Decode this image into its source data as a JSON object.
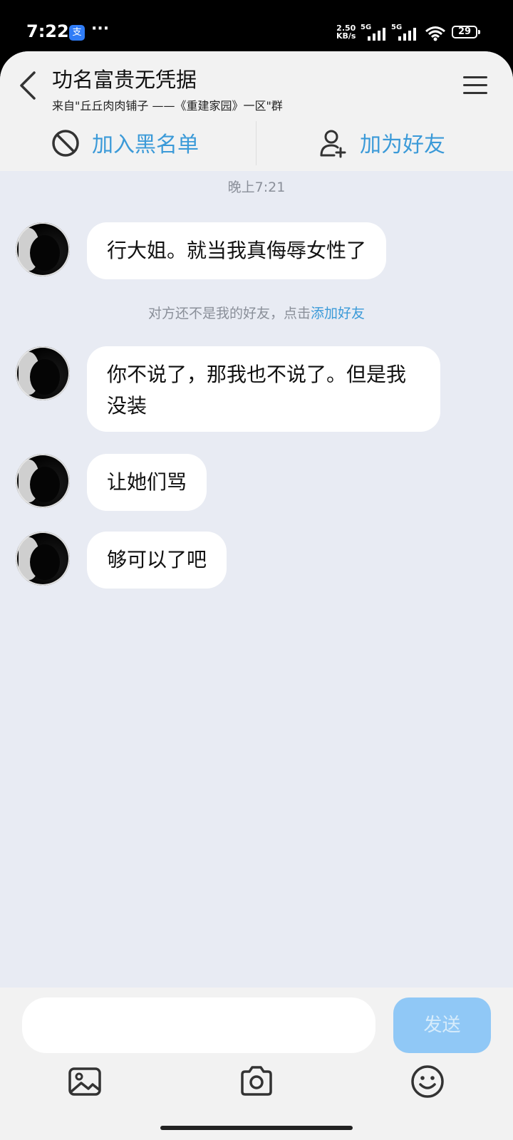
{
  "status_bar": {
    "time": "7:22",
    "app_icon": "支",
    "dots": "···",
    "net_speed_value": "2.50",
    "net_speed_unit": "KB/s",
    "signal1_label": "5G",
    "signal2_label": "5G",
    "battery": "29"
  },
  "header": {
    "title": "功名富贵无凭据",
    "subtitle": "来自\"丘丘肉肉铺子 ——《重建家园》一区\"群"
  },
  "actions": {
    "block_label": "加入黑名单",
    "add_friend_label": "加为好友"
  },
  "chat": {
    "timestamp": "晚上7:21",
    "notice_text": "对方还不是我的好友，点击",
    "notice_link": "添加好友",
    "messages": [
      {
        "text": "行大姐。就当我真侮辱女性了"
      },
      {
        "text": "你不说了，那我也不说了。但是我没装"
      },
      {
        "text": "让她们骂"
      },
      {
        "text": "够可以了吧"
      }
    ]
  },
  "input": {
    "placeholder": "",
    "send_label": "发送"
  },
  "icons": {
    "back": "back-arrow-icon",
    "menu": "menu-icon",
    "block": "block-icon",
    "add_friend": "add-friend-icon",
    "image": "image-icon",
    "camera": "camera-icon",
    "emoji": "emoji-icon"
  },
  "colors": {
    "accent": "#3b9ad8",
    "chat_background": "#e8ebf3",
    "send_button": "#90c8f6"
  }
}
